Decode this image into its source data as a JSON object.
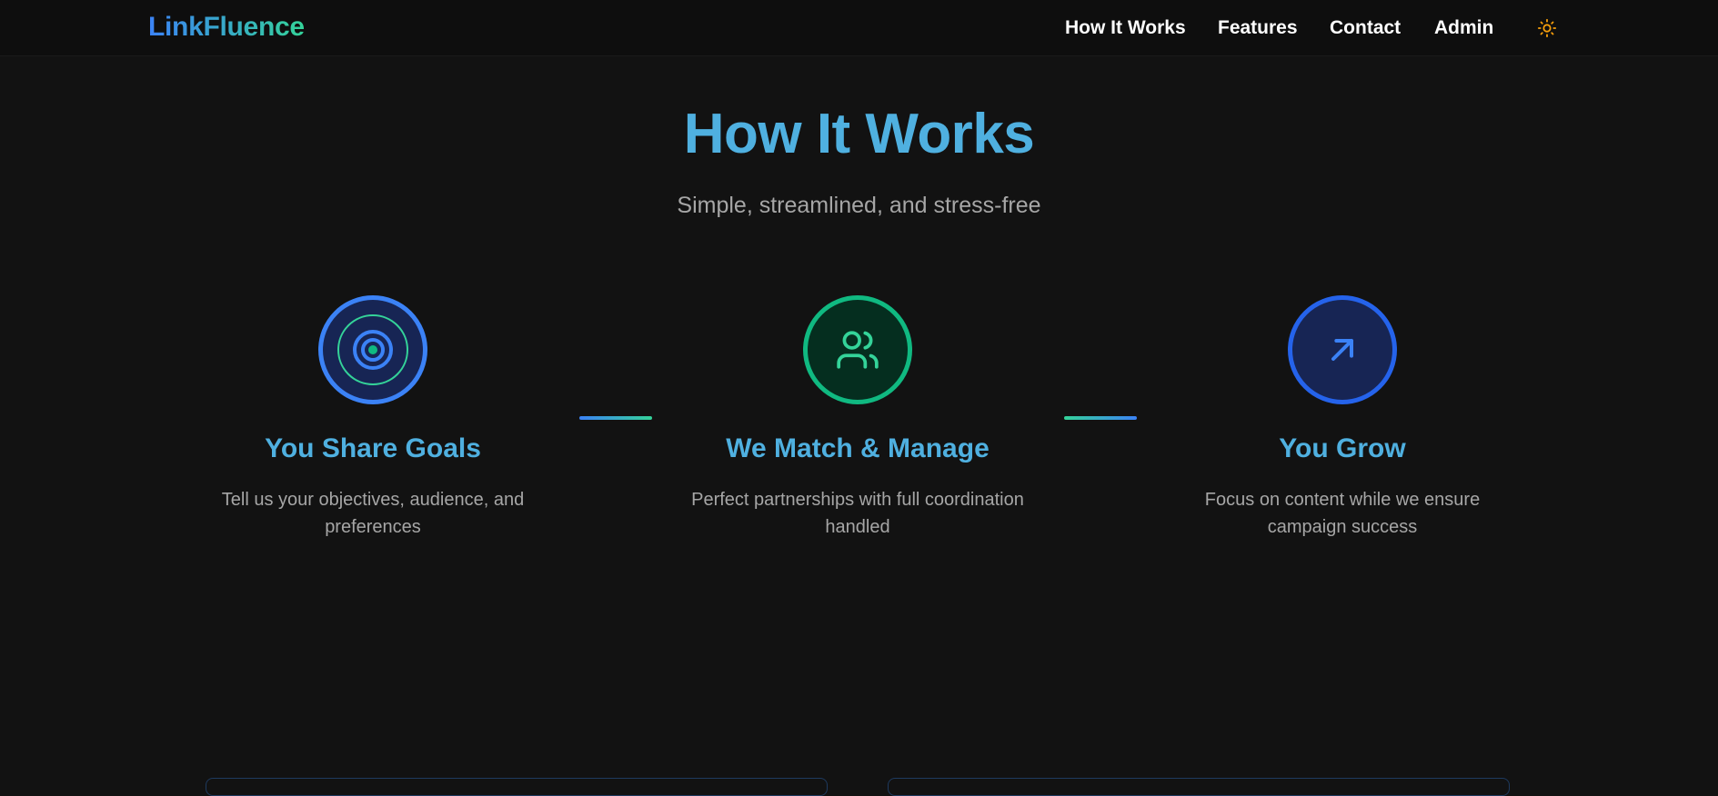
{
  "nav": {
    "logo": "LinkFluence",
    "links": [
      "How It Works",
      "Features",
      "Contact",
      "Admin"
    ],
    "theme_icon": "sun-icon"
  },
  "hero": {
    "title": "How It Works",
    "subtitle": "Simple, streamlined, and stress-free"
  },
  "steps": [
    {
      "icon": "target-icon",
      "title": "You Share Goals",
      "description": "Tell us your objectives, audience, and preferences"
    },
    {
      "icon": "users-icon",
      "title": "We Match & Manage",
      "description": "Perfect partnerships with full coordination handled"
    },
    {
      "icon": "arrow-up-right-icon",
      "title": "You Grow",
      "description": "Focus on content while we ensure campaign success"
    }
  ],
  "colors": {
    "accent_blue": "#3b82f6",
    "accent_green": "#10b981",
    "heading": "#4fb0e0",
    "background": "#121212"
  }
}
